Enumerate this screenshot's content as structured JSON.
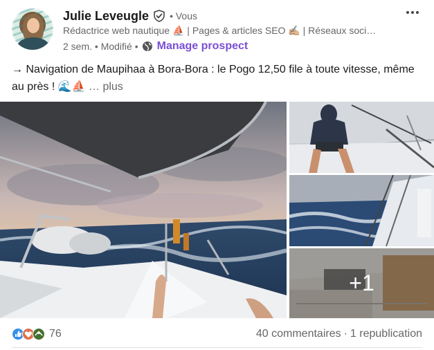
{
  "author": {
    "name": "Julie Leveugle",
    "relation": "• Vous",
    "headline": "Rédactrice web nautique ⛵ | Pages & articles SEO ✍🏼 | Réseaux soci…",
    "time": "2 sem. • Modifié •",
    "action": "Manage prospect"
  },
  "post": {
    "text": "→ Navigation de Maupihaa à Bora-Bora : le Pogo 12,50 file à toute vitesse, même au près ! 🌊⛵",
    "see_more": "… plus",
    "extra_images": "+1"
  },
  "social": {
    "reaction_count": "76",
    "comments": "40 commentaires",
    "separator": "·",
    "reposts": "1 republication"
  },
  "icons": {
    "verified": "shield-check-icon",
    "visibility": "globe-icon",
    "more": "ellipsis-icon",
    "reactions": [
      "like-icon",
      "love-icon",
      "support-icon"
    ]
  },
  "colors": {
    "accent": "#7a4fd4",
    "like": "#378fe9",
    "love": "#df704d",
    "support": "#44712e"
  }
}
